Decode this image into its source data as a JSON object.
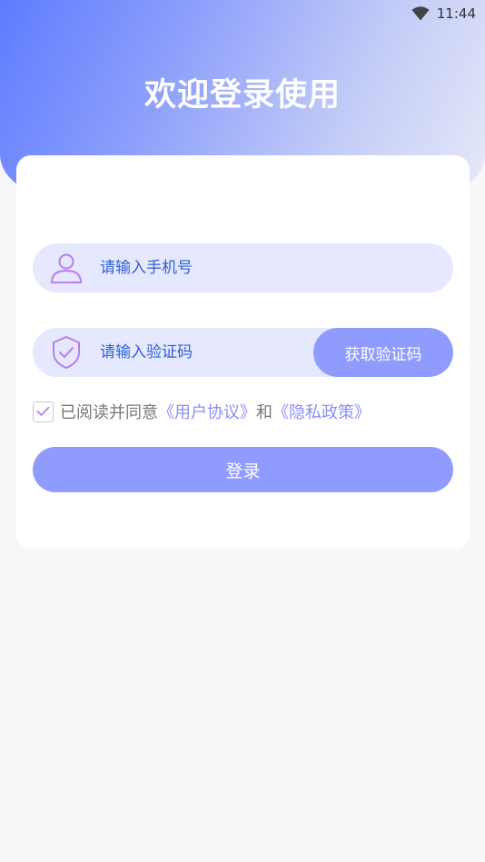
{
  "status_bar": {
    "time": "11:44",
    "icons": [
      "wifi-icon"
    ]
  },
  "header": {
    "title": "欢迎登录使用"
  },
  "form": {
    "phone": {
      "icon": "user-icon",
      "placeholder": "请输入手机号",
      "value": ""
    },
    "code": {
      "icon": "shield-check-icon",
      "placeholder": "请输入验证码",
      "value": "",
      "get_code_label": "获取验证码"
    },
    "agreement": {
      "checked": true,
      "prefix": "已阅读并同意",
      "user_agreement": "《用户协议》",
      "conjunction": "和",
      "privacy_policy": "《隐私政策》"
    },
    "login_label": "登录"
  },
  "colors": {
    "accent": "#8f9bfd",
    "field_bg": "#e6e8fe",
    "placeholder": "#2e62d6",
    "link": "#8a8ff5",
    "icon": "#b57ef0",
    "background": "#f7f7f8"
  }
}
